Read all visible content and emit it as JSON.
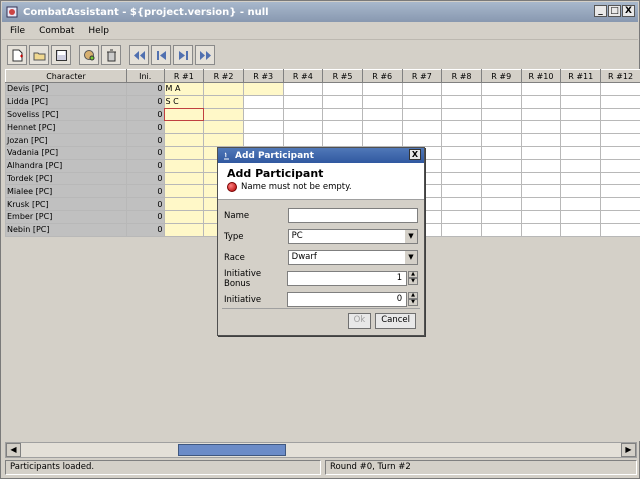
{
  "window": {
    "title": "CombatAssistant - ${project.version} - null",
    "min": "_",
    "max": "□",
    "close": "X"
  },
  "menu": [
    "File",
    "Combat",
    "Help"
  ],
  "columns": [
    "Character",
    "Ini.",
    "R #1",
    "R #2",
    "R #3",
    "R #4",
    "R #5",
    "R #6",
    "R #7",
    "R #8",
    "R #9",
    "R #10",
    "R #11",
    "R #12"
  ],
  "rows": [
    {
      "name": "Devis [PC]",
      "ini": "0",
      "r1": "M A"
    },
    {
      "name": "Lidda [PC]",
      "ini": "0",
      "r1": "S C"
    },
    {
      "name": "Soveliss [PC]",
      "ini": "0",
      "r1": ""
    },
    {
      "name": "Hennet [PC]",
      "ini": "0",
      "r1": ""
    },
    {
      "name": "Jozan [PC]",
      "ini": "0",
      "r1": ""
    },
    {
      "name": "Vadania [PC]",
      "ini": "0",
      "r1": ""
    },
    {
      "name": "Alhandra [PC]",
      "ini": "0",
      "r1": ""
    },
    {
      "name": "Tordek [PC]",
      "ini": "0",
      "r1": ""
    },
    {
      "name": "Mialee [PC]",
      "ini": "0",
      "r1": ""
    },
    {
      "name": "Krusk [PC]",
      "ini": "0",
      "r1": ""
    },
    {
      "name": "Ember [PC]",
      "ini": "0",
      "r1": ""
    },
    {
      "name": "Nebin [PC]",
      "ini": "0",
      "r1": ""
    }
  ],
  "status": {
    "left": "Participants loaded.",
    "right": "Round #0, Turn #2"
  },
  "dialog": {
    "title": "Add Participant",
    "heading": "Add Participant",
    "error": "Name must not be empty.",
    "close": "X",
    "fields": {
      "name_label": "Name",
      "name_value": "",
      "type_label": "Type",
      "type_value": "PC",
      "race_label": "Race",
      "race_value": "Dwarf",
      "bonus_label": "Initiative Bonus",
      "bonus_value": "1",
      "init_label": "Initiative",
      "init_value": "0"
    },
    "ok": "Ok",
    "cancel": "Cancel"
  }
}
